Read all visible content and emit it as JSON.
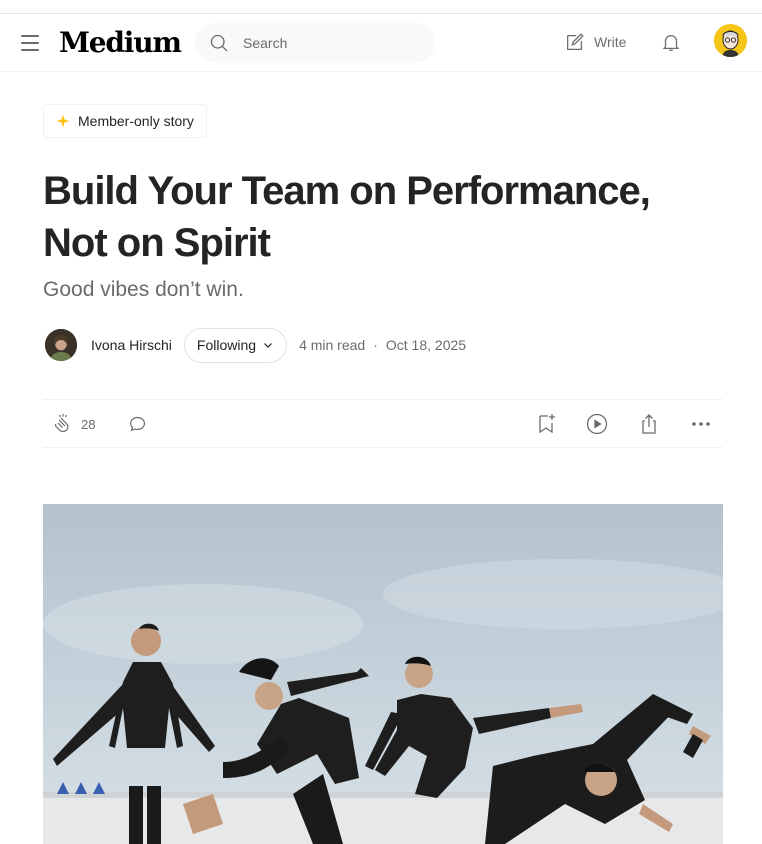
{
  "header": {
    "logo": "Medium",
    "search_placeholder": "Search",
    "write_label": "Write"
  },
  "article": {
    "badge": "Member-only story",
    "title": "Build Your Team on Performance, Not on Spirit",
    "subtitle": "Good vibes don’t win.",
    "author": "Ivona Hirschi",
    "follow_label": "Following",
    "read_time": "4 min read",
    "date": "Oct 18, 2025",
    "claps": "28"
  },
  "colors": {
    "text": "#242424",
    "muted": "#6b6b6b",
    "star": "#ffc017",
    "avatar_bg": "#f5c518"
  },
  "icons": [
    "menu-icon",
    "search-icon",
    "write-icon",
    "bell-icon",
    "star-icon",
    "chevron-down-icon",
    "clap-icon",
    "comment-icon",
    "bookmark-icon",
    "play-icon",
    "share-icon",
    "more-icon"
  ]
}
